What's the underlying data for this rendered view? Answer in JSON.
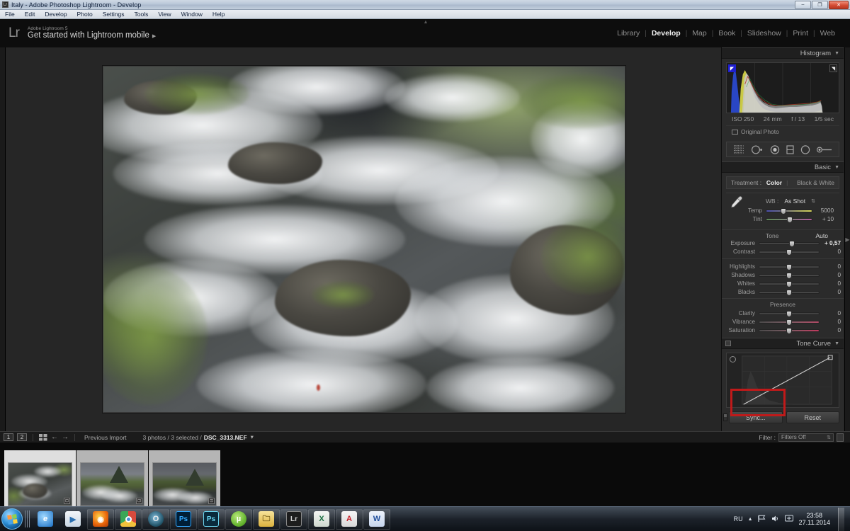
{
  "window": {
    "title": "Italy - Adobe Photoshop Lightroom - Develop",
    "icon": "lr-icon",
    "minimize": "–",
    "restore": "❐",
    "close": "✕"
  },
  "menubar": {
    "items": [
      "File",
      "Edit",
      "Develop",
      "Photo",
      "Settings",
      "Tools",
      "View",
      "Window",
      "Help"
    ]
  },
  "identity": {
    "logo": "Lr",
    "product": "Adobe Lightroom 5",
    "tagline": "Get started with Lightroom mobile",
    "arrow": "▶"
  },
  "modules": {
    "items": [
      "Library",
      "Develop",
      "Map",
      "Book",
      "Slideshow",
      "Print",
      "Web"
    ],
    "active": "Develop",
    "separator": "|"
  },
  "histogram": {
    "title": "Histogram",
    "triangle": "▼",
    "shadow_clip": "◤",
    "highlight_clip": "◥",
    "exif": {
      "iso": "ISO 250",
      "focal": "24 mm",
      "aperture": "f / 13",
      "shutter": "1/5 sec"
    },
    "original_photo": "Original Photo"
  },
  "tools": {
    "items": [
      "crop-overlay-icon",
      "spot-removal-icon",
      "red-eye-icon",
      "graduated-filter-icon",
      "radial-filter-icon",
      "adjustment-brush-icon"
    ]
  },
  "basic": {
    "title": "Basic",
    "triangle": "▼",
    "treatment_label": "Treatment :",
    "treatment_options": [
      "Color",
      "Black & White"
    ],
    "treatment_active": "Color",
    "wb_label": "WB :",
    "wb_value": "As Shot",
    "wb_stepper": "⇅",
    "sliders": [
      {
        "label": "Temp",
        "value": "5000",
        "pos": 37,
        "track": "temp"
      },
      {
        "label": "Tint",
        "value": "+ 10",
        "pos": 52,
        "track": "tint"
      },
      {
        "label": "Exposure",
        "value": "+ 0,57",
        "pos": 55,
        "track": "plain"
      },
      {
        "label": "Contrast",
        "value": "0",
        "pos": 50,
        "track": "plain"
      },
      {
        "label": "Highlights",
        "value": "0",
        "pos": 50,
        "track": "plain"
      },
      {
        "label": "Shadows",
        "value": "0",
        "pos": 50,
        "track": "plain"
      },
      {
        "label": "Whites",
        "value": "0",
        "pos": 50,
        "track": "plain"
      },
      {
        "label": "Blacks",
        "value": "0",
        "pos": 50,
        "track": "plain"
      },
      {
        "label": "Clarity",
        "value": "0",
        "pos": 50,
        "track": "plain"
      },
      {
        "label": "Vibrance",
        "value": "0",
        "pos": 50,
        "track": "vib"
      },
      {
        "label": "Saturation",
        "value": "0",
        "pos": 50,
        "track": "sat"
      }
    ],
    "tone_label": "Tone",
    "auto_label": "Auto",
    "presence_label": "Presence"
  },
  "tone_curve": {
    "title": "Tone Curve",
    "triangle": "▼",
    "target_adjust": "target-adjust-icon"
  },
  "buttons": {
    "sync": "Sync...",
    "reset": "Reset",
    "sync_highlighted": true
  },
  "filmstrip_bar": {
    "view_1": "1",
    "view_2": "2",
    "grid_icon": "grid-icon",
    "back_arrow": "←",
    "forward_arrow": "→",
    "source": "Previous Import",
    "status": "3 photos / 3 selected / ",
    "filename": "DSC_3313.NEF",
    "dropdown": "▾",
    "filter_label": "Filter :",
    "filter_value": "Filters Off",
    "filter_spinner": "⇅",
    "lock_icon": "lock-icon"
  },
  "filmstrip": {
    "thumbs": [
      {
        "name": "waterfall-rocks",
        "selected": true,
        "badge": "⊡",
        "kind": "water"
      },
      {
        "name": "kirkjufell-stream-1",
        "selected": false,
        "badge": "⊡",
        "kind": "mountain"
      },
      {
        "name": "kirkjufell-stream-2",
        "selected": false,
        "badge": "⊡",
        "kind": "mountain"
      }
    ]
  },
  "panel_arrows": {
    "top": "▲",
    "right": "▶"
  },
  "taskbar": {
    "start": "start-orb",
    "apps": [
      {
        "name": "internet-explorer",
        "glyph": "e",
        "color": "#1a6fc4"
      },
      {
        "name": "windows-media-player",
        "glyph": "▶",
        "color": "#2a6fb0"
      },
      {
        "name": "firefox",
        "glyph": "🦊",
        "color": "#e8630a"
      },
      {
        "name": "google-chrome",
        "glyph": "◉",
        "color": "#3aa757"
      },
      {
        "name": "opera",
        "glyph": "O",
        "color": "#c0392b"
      },
      {
        "name": "photoshop",
        "glyph": "Ps",
        "color": "#001e36"
      },
      {
        "name": "photoshop-2",
        "glyph": "Ps",
        "color": "#0a2b3c"
      },
      {
        "name": "utorrent",
        "glyph": "µ",
        "color": "#63b32e"
      },
      {
        "name": "file-explorer",
        "glyph": "🗀",
        "color": "#e8c96a"
      },
      {
        "name": "lightroom",
        "glyph": "Lr",
        "color": "#1d1d1d"
      },
      {
        "name": "excel",
        "glyph": "X",
        "color": "#1d7044"
      },
      {
        "name": "adobe-reader",
        "glyph": "A",
        "color": "#c8202a"
      },
      {
        "name": "word",
        "glyph": "W",
        "color": "#1f4e9c"
      }
    ],
    "tray": {
      "language": "RU",
      "show_hidden": "▲",
      "network": "network-icon",
      "volume": "volume-icon",
      "action_center": "action-center-icon",
      "time": "23:58",
      "date": "27.11.2014"
    }
  }
}
